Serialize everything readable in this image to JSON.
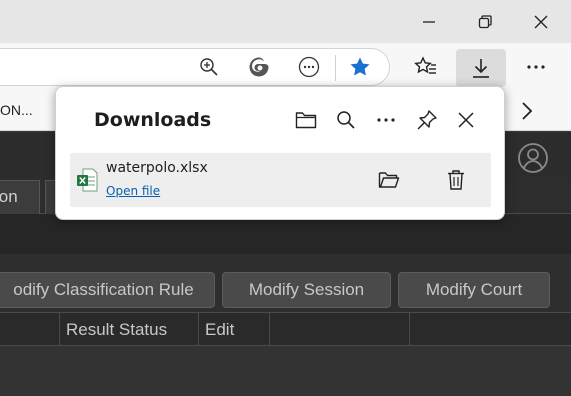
{
  "browser": {
    "favorites_bar_item": "ON...",
    "icons": {
      "minimize": "minimize-icon",
      "restore": "restore-icon",
      "close": "close-icon",
      "zoom": "zoom-in-icon",
      "edge": "edge-icon",
      "more": "more-icon",
      "favorite": "star-icon",
      "favorites": "favorites-icon",
      "downloads": "download-icon",
      "settings": "ellipsis-icon",
      "chevron": "chevron-right-icon"
    },
    "accent_color": "#1a6fd1"
  },
  "downloads_panel": {
    "title": "Downloads",
    "items": [
      {
        "file_name": "waterpolo.xlsx",
        "action_label": "Open file"
      }
    ]
  },
  "app": {
    "tabs": [
      "ion",
      ""
    ],
    "buttons": [
      "odify Classification Rule",
      "Modify Session",
      "Modify Court"
    ],
    "columns": [
      "",
      "Result Status",
      "Edit",
      ""
    ]
  }
}
